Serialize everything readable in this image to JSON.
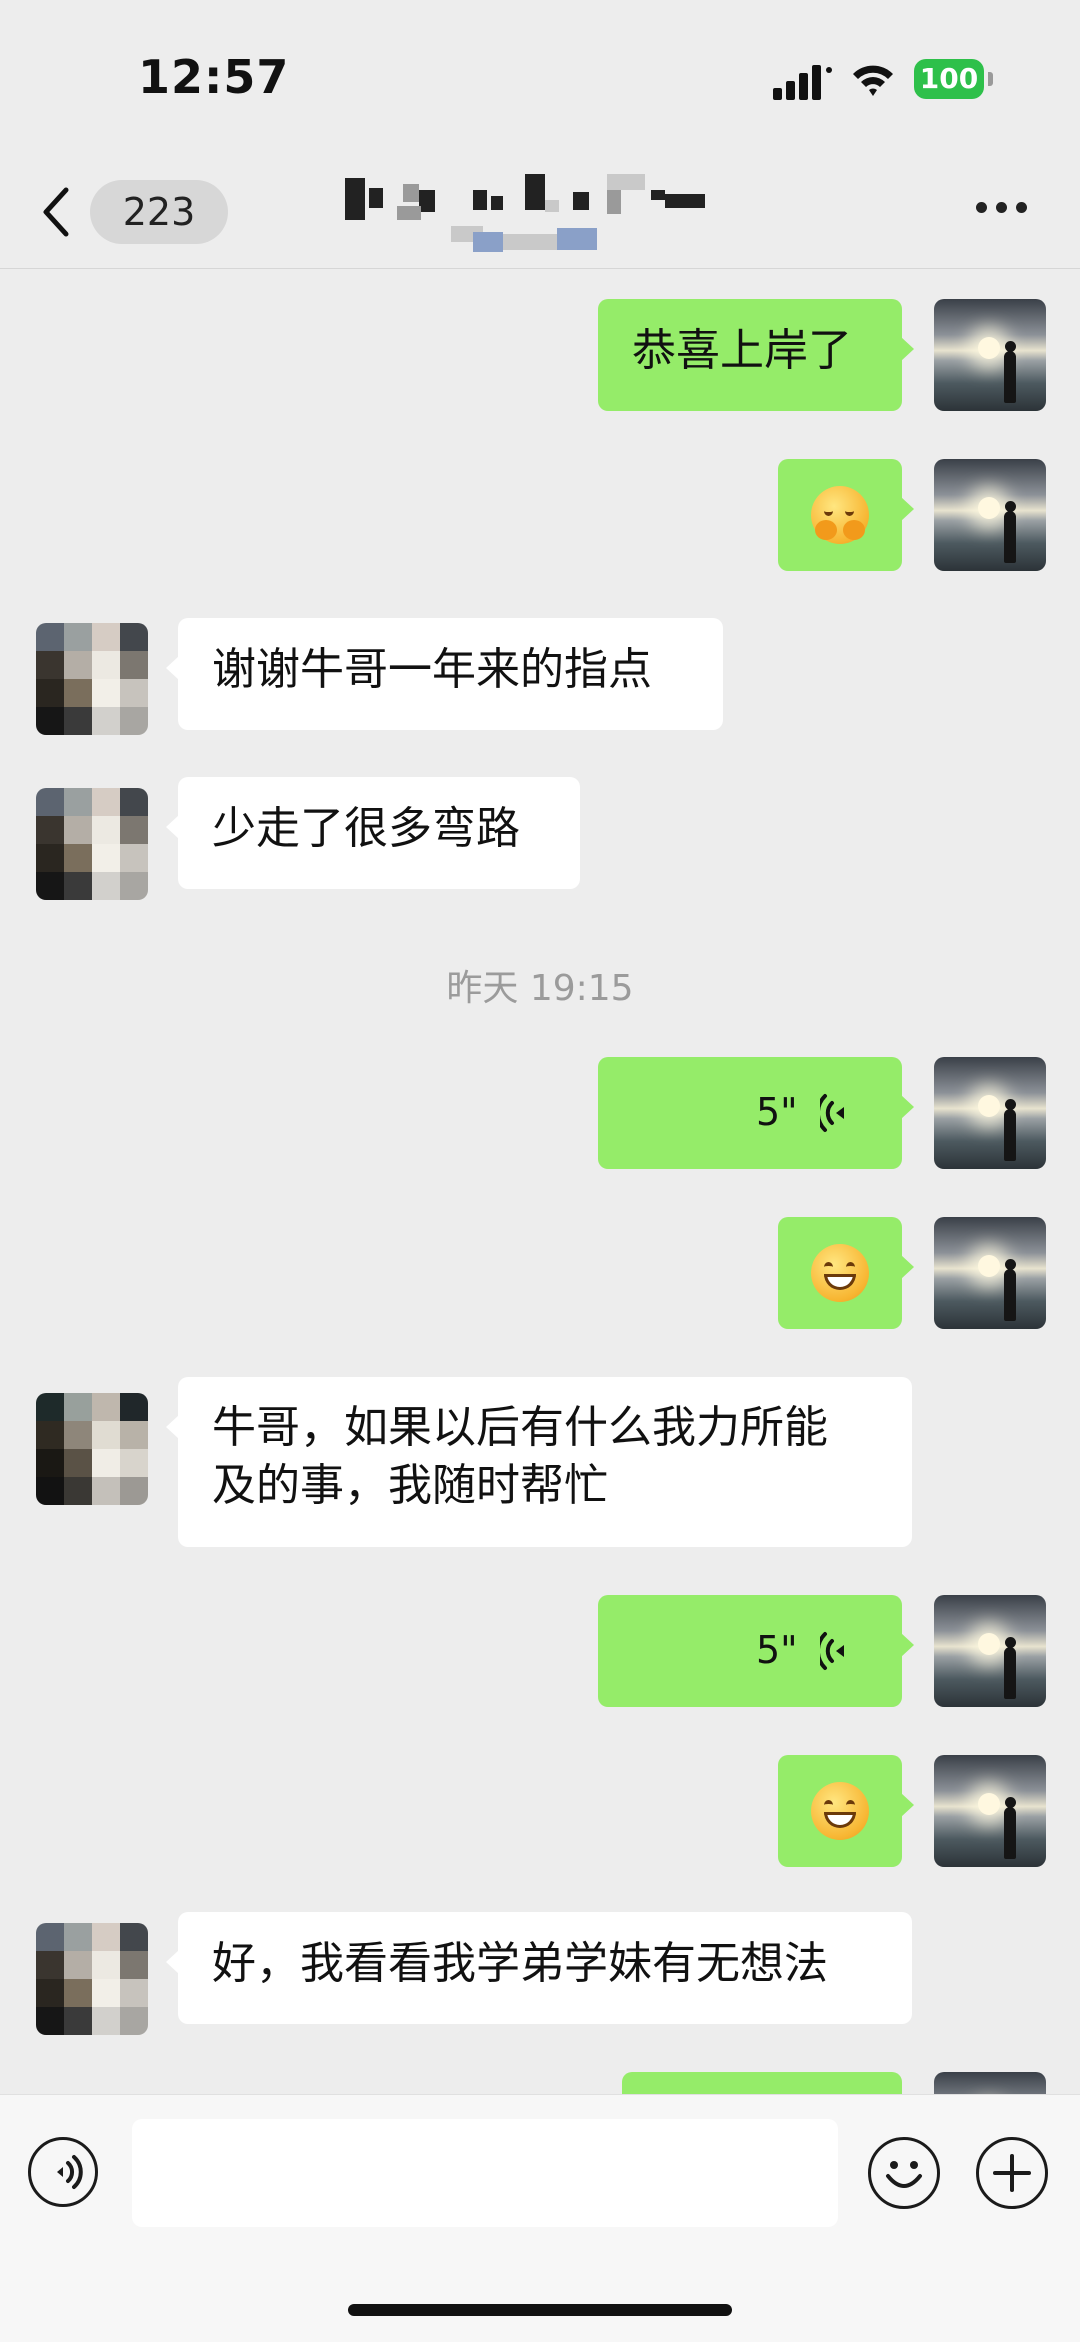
{
  "status_bar": {
    "time": "12:57",
    "battery": "100",
    "signal_icon": "signal-bars-icon",
    "wifi_icon": "wifi-icon"
  },
  "header": {
    "unread_count": "223",
    "title_pixelated": true,
    "back_icon": "chevron-left-icon",
    "more_icon": "more-dots-icon"
  },
  "messages": [
    {
      "side": "me",
      "type": "text",
      "text": "恭喜上岸了"
    },
    {
      "side": "me",
      "type": "emoji",
      "emoji": "blush-hands-emoji"
    },
    {
      "side": "other",
      "type": "text",
      "text": "谢谢牛哥一年来的指点"
    },
    {
      "side": "other",
      "type": "text",
      "text": "少走了很多弯路"
    },
    {
      "type": "timestamp",
      "text": "昨天 19:15"
    },
    {
      "side": "me",
      "type": "voice",
      "duration": "5\""
    },
    {
      "side": "me",
      "type": "emoji",
      "emoji": "grin-emoji"
    },
    {
      "side": "other",
      "type": "text",
      "text": "牛哥，如果以后有什么我力所能\n及的事，我随时帮忙",
      "lines": [
        "牛哥，如果以后有什么我力所能",
        "及的事，我随时帮忙"
      ]
    },
    {
      "side": "me",
      "type": "voice",
      "duration": "5\""
    },
    {
      "side": "me",
      "type": "emoji",
      "emoji": "grin-emoji"
    },
    {
      "side": "other",
      "type": "text",
      "text": "好，我看看我学弟学妹有无想法"
    }
  ],
  "input_bar": {
    "placeholder": "",
    "voice_icon": "voice-toggle-icon",
    "emoji_icon": "emoji-face-icon",
    "plus_icon": "plus-icon"
  },
  "colors": {
    "background": "#ededed",
    "my_bubble": "#95ec69",
    "other_bubble": "#ffffff",
    "battery": "#2ec04a"
  }
}
